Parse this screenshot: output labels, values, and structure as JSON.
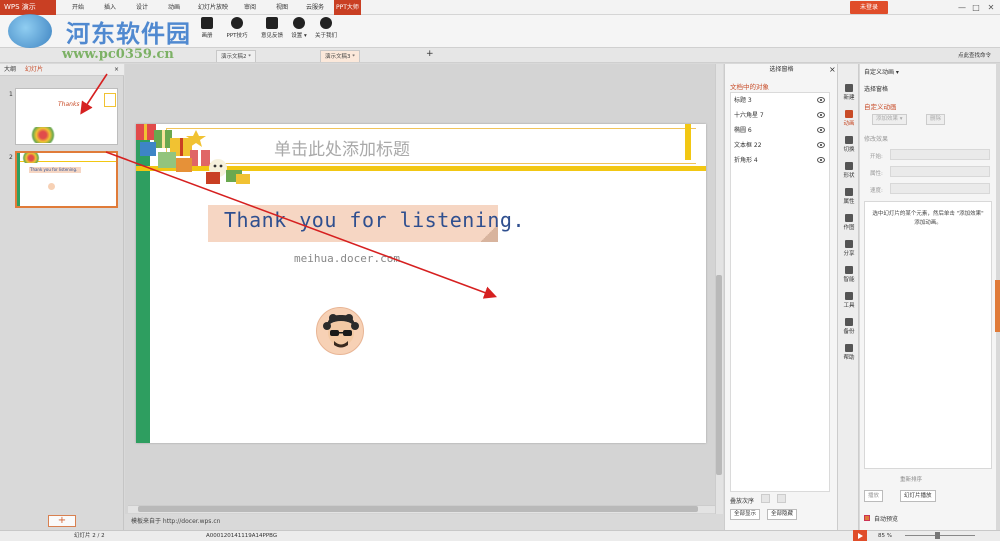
{
  "app": {
    "name": "WPS 演示"
  },
  "menu": {
    "items": [
      "开始",
      "插入",
      "设计",
      "动画",
      "幻灯片放映",
      "审阅",
      "视图",
      "云服务",
      "PPT大师"
    ],
    "login": "未登录",
    "window_controls": [
      "—",
      "□",
      "✕"
    ]
  },
  "ribbon": {
    "tools": [
      "画册",
      "PPT技巧",
      "意见反馈",
      "设置 ▾",
      "关于我们"
    ]
  },
  "watermark": {
    "title": "河东软件园",
    "url": "www.pc0359.cn"
  },
  "tabs": {
    "items": [
      "演示文稿2 *",
      "演示文稿3 *"
    ],
    "right_text": "点此查找命令"
  },
  "left_pane": {
    "tabs": [
      "大纲",
      "幻灯片"
    ],
    "slide_numbers": [
      "1",
      "2"
    ],
    "thumb1_title": "Thanks",
    "thumb2_text": "Thank you for listening.",
    "add_label": "+"
  },
  "slide": {
    "title_placeholder": "单击此处添加标题",
    "thank_text": "Thank you for listening.",
    "website": "meihua.docer.com"
  },
  "editor": {
    "template_note": "模板来自于 http://docer.wps.cn"
  },
  "selection_pane": {
    "title": "选择窗格",
    "subtitle": "文档中的对象",
    "objects": [
      "标题 3",
      "十六角星 7",
      "椭圆 6",
      "文本框 22",
      "折角形 4"
    ],
    "order_label": "叠放次序",
    "show_all": "全部显示",
    "hide_all": "全部隐藏"
  },
  "right_toolbar": {
    "items": [
      "新建",
      "动画",
      "切换",
      "形状",
      "属性",
      "作图",
      "分享",
      "智能",
      "工具",
      "备份",
      "帮助"
    ]
  },
  "anim_pane": {
    "title": "自定义动画 ▾",
    "select_pane": "选择窗格",
    "custom_anim": "自定义动画",
    "add_effect": "添加效果 ▾",
    "delete": "删除",
    "modify": "修改效果",
    "field_labels": [
      "开始:",
      "属性:",
      "速度:"
    ],
    "tip": "选中幻灯片的某个元素，然后单击 \"添加效果\" 添加动画。",
    "reorder": "重新排序",
    "play": "播放",
    "slideshow": "幻灯片播放",
    "auto_preview": "自动预览"
  },
  "status": {
    "slide_info": "幻灯片 2 / 2",
    "file_id": "A000120141119A14PPBG",
    "zoom": "85 %"
  },
  "colors": {
    "brand": "#c93f23",
    "accent": "#e07b39",
    "slide_green": "#2e9e60",
    "slide_yellow": "#f2c713",
    "arrow_red": "#d62020"
  }
}
